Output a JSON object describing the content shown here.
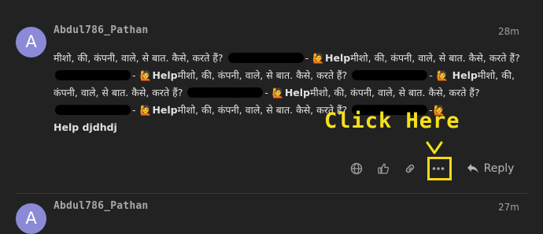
{
  "posts": [
    {
      "avatar_letter": "A",
      "username": "Abdul786_Pathan",
      "time": "28m",
      "body": {
        "seg1": "मीशो, की, कंपनी, वाले, से बात. कैसे, करते हैं?",
        "sep": "-",
        "help": "Help",
        "seg2": "मीशो, की, कंपनी, वाले, से बात. कैसे,",
        "seg3": "करते हैं?",
        "seg4": "मीशो, की, कंपनी, वाले, से बात. कैसे, करते हैं?",
        "seg5": "मीशो, की, कंपनी, वाले, से बात. कैसे, करते हैं?",
        "seg6": "मीशो, की, कंपनी, वाले, से बात.",
        "seg7": "कैसे, करते हैं?",
        "seg8": "मीशो, की, कंपनी, वाले, से बात. कैसे, करते हैं?",
        "tail": "Help djdhdj"
      },
      "actions": {
        "reply_label": "Reply"
      }
    },
    {
      "avatar_letter": "A",
      "username": "Abdul786_Pathan",
      "time": "27m"
    }
  ],
  "annotation": {
    "text": "Click Here",
    "color": "#f5e11c"
  },
  "icons": [
    "globe-icon",
    "like-icon",
    "link-icon",
    "more-icon",
    "reply-icon"
  ],
  "colors": {
    "background": "#222222",
    "avatar": "#8a8ad6",
    "highlight": "#f5d914"
  }
}
